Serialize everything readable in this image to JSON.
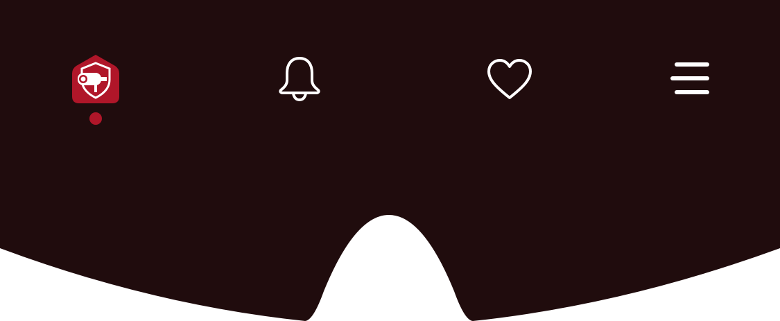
{
  "colors": {
    "bar_background": "#200c0d",
    "page_background": "#ffffff",
    "accent": "#b01629",
    "icon_stroke": "#ffffff"
  },
  "bottom_nav": {
    "active_index": 0,
    "items": [
      {
        "id": "home",
        "icon": "security-camera-shield-icon",
        "active": true
      },
      {
        "id": "notifications",
        "icon": "bell-icon",
        "active": false
      },
      {
        "id": "favorites",
        "icon": "heart-icon",
        "active": false
      },
      {
        "id": "menu",
        "icon": "hamburger-menu-icon",
        "active": false
      }
    ]
  }
}
